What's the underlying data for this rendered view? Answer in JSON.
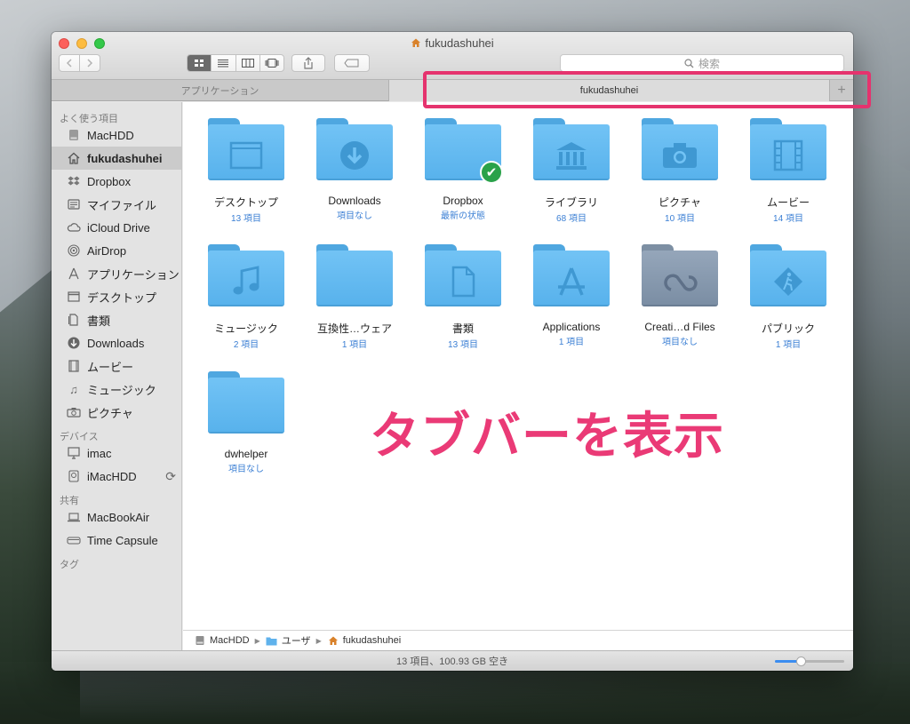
{
  "window": {
    "title": "fukudashuhei",
    "search_placeholder": "検索"
  },
  "tabs": {
    "applications": "アプリケーション",
    "active": "fukudashuhei",
    "add": "+"
  },
  "sidebar": {
    "favorites_header": "よく使う項目",
    "favorites": [
      {
        "label": "MacHDD",
        "icon": "harddisk-icon"
      },
      {
        "label": "fukudashuhei",
        "icon": "home-icon"
      },
      {
        "label": "Dropbox",
        "icon": "dropbox-icon"
      },
      {
        "label": "マイファイル",
        "icon": "all-my-files-icon"
      },
      {
        "label": "iCloud Drive",
        "icon": "cloud-icon"
      },
      {
        "label": "AirDrop",
        "icon": "airdrop-icon"
      },
      {
        "label": "アプリケーション",
        "icon": "applications-icon"
      },
      {
        "label": "デスクトップ",
        "icon": "desktop-icon"
      },
      {
        "label": "書類",
        "icon": "documents-icon"
      },
      {
        "label": "Downloads",
        "icon": "download-icon"
      },
      {
        "label": "ムービー",
        "icon": "movie-icon"
      },
      {
        "label": "ミュージック",
        "icon": "music-icon"
      },
      {
        "label": "ピクチャ",
        "icon": "camera-icon"
      }
    ],
    "devices_header": "デバイス",
    "devices": [
      {
        "label": "imac",
        "icon": "imac-icon"
      },
      {
        "label": "iMacHDD",
        "icon": "timemachine-icon"
      }
    ],
    "shared_header": "共有",
    "shared": [
      {
        "label": "MacBookAir",
        "icon": "laptop-icon"
      },
      {
        "label": "Time Capsule",
        "icon": "timecapsule-icon"
      }
    ],
    "tags_header": "タグ"
  },
  "files": [
    {
      "name": "デスクトップ",
      "sub": "13 項目",
      "glyph": "desktop-glyph"
    },
    {
      "name": "Downloads",
      "sub": "項目なし",
      "glyph": "download-glyph"
    },
    {
      "name": "Dropbox",
      "sub": "最新の状態",
      "glyph": "none",
      "badge": "✔"
    },
    {
      "name": "ライブラリ",
      "sub": "68 項目",
      "glyph": "library-glyph"
    },
    {
      "name": "ピクチャ",
      "sub": "10 項目",
      "glyph": "camera-glyph"
    },
    {
      "name": "ムービー",
      "sub": "14 項目",
      "glyph": "film-glyph"
    },
    {
      "name": "ミュージック",
      "sub": "2 項目",
      "glyph": "music-glyph"
    },
    {
      "name": "互換性…ウェア",
      "sub": "1 項目",
      "glyph": "none"
    },
    {
      "name": "書類",
      "sub": "13 項目",
      "glyph": "document-glyph"
    },
    {
      "name": "Applications",
      "sub": "1 項目",
      "glyph": "applications-glyph"
    },
    {
      "name": "Creati…d Files",
      "sub": "項目なし",
      "glyph": "creative-cloud-glyph"
    },
    {
      "name": "パブリック",
      "sub": "1 項目",
      "glyph": "public-glyph"
    },
    {
      "name": "dwhelper",
      "sub": "項目なし",
      "glyph": "none"
    }
  ],
  "annotation": "タブバーを表示",
  "pathbar": [
    {
      "label": "MacHDD",
      "icon": "harddisk-icon"
    },
    {
      "label": "ユーザ",
      "icon": "folder-icon"
    },
    {
      "label": "fukudashuhei",
      "icon": "home-icon"
    }
  ],
  "status": "13 項目、100.93 GB 空き",
  "zoom_level": 0.37,
  "colors": {
    "accent": "#3b8df0",
    "annotation": "#ea3a76",
    "folder": "#62b8ef"
  }
}
